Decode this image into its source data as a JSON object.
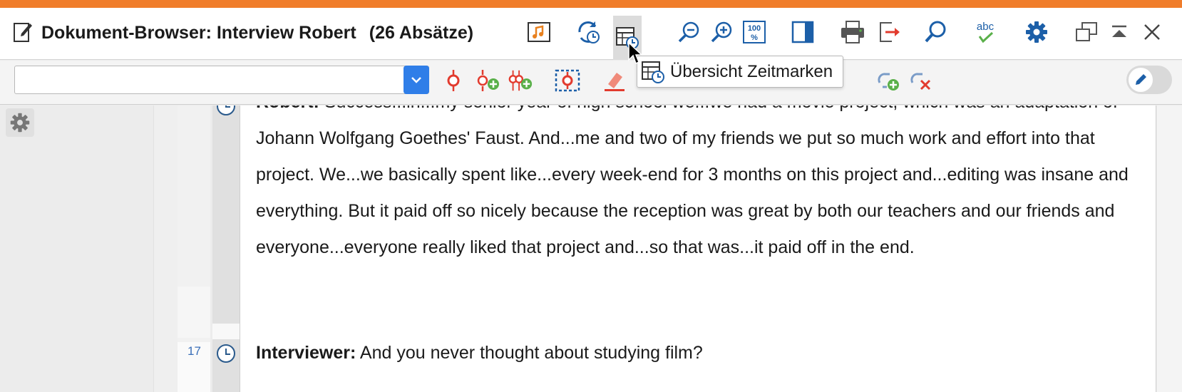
{
  "window": {
    "title": "Dokument-Browser: Interview Robert",
    "paragraph_count": "(26 Absätze)",
    "accent_color": "#f07d2a"
  },
  "titlebar_buttons": [
    {
      "name": "audio-icon"
    },
    {
      "name": "sync-timestamps-icon"
    },
    {
      "name": "timestamps-overview-icon"
    },
    {
      "name": "zoom-out-icon"
    },
    {
      "name": "zoom-in-icon"
    },
    {
      "name": "zoom-100-icon"
    },
    {
      "name": "panel-toggle-icon"
    },
    {
      "name": "print-icon"
    },
    {
      "name": "export-icon"
    },
    {
      "name": "search-icon"
    },
    {
      "name": "spellcheck-icon"
    },
    {
      "name": "settings-icon"
    },
    {
      "name": "undock-icon"
    },
    {
      "name": "collapse-icon"
    },
    {
      "name": "close-icon"
    }
  ],
  "toolbar2": {
    "combo_value": "",
    "toggle_state": "off"
  },
  "tooltip": {
    "text": "Übersicht Zeitmarken"
  },
  "document": {
    "paragraph_16": {
      "speaker": "Robert:",
      "text": " Success...in...my senior year of high school we...we had a movie project, which was an adaptation of Johann Wolfgang Goethes' Faust. And...me and two of my friends we put so much work and effort into that project. We...we basically spent like...every week-end for 3 months on this project and...editing was insane and everything. But it paid off so nicely because the reception was great by both our teachers and our friends and everyone...everyone really liked that project and...so that was...it paid off in the end."
    },
    "paragraph_17": {
      "number": "17",
      "speaker": "Interviewer:",
      "text": " And you never thought about studying film?"
    }
  },
  "colors": {
    "icon_blue": "#1c5fa8",
    "icon_red": "#e23b2e",
    "icon_green": "#5ab04a",
    "combo_blue": "#2f7ee8"
  }
}
